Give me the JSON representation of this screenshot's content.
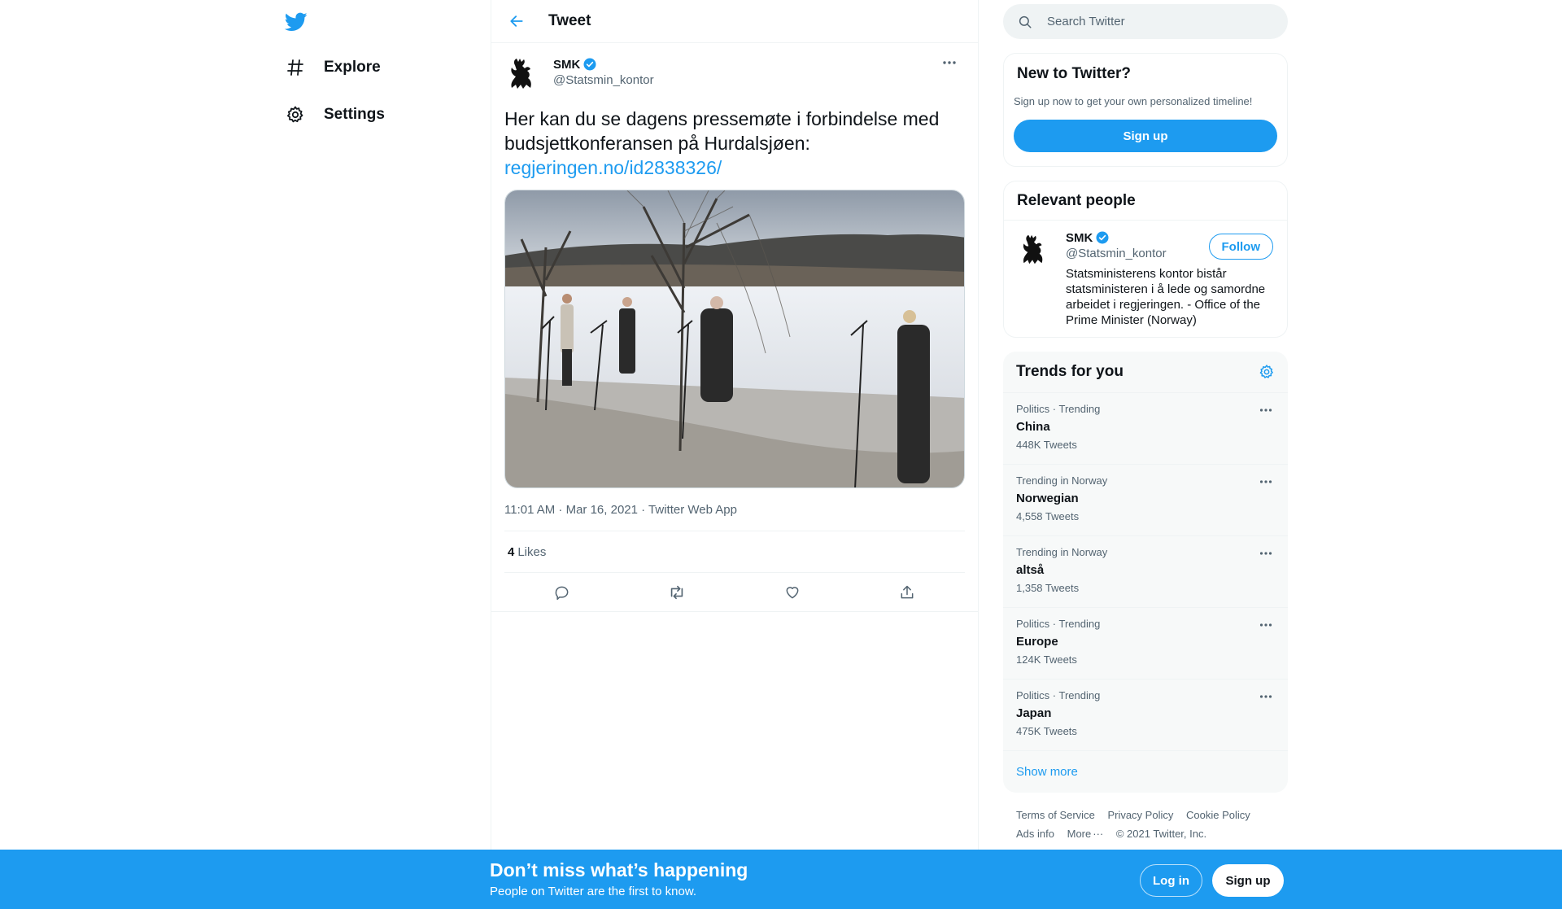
{
  "nav": {
    "logo_icon": "twitter-bird-icon",
    "items": [
      {
        "label": "Explore",
        "icon": "hashtag-icon"
      },
      {
        "label": "Settings",
        "icon": "gear-icon"
      }
    ]
  },
  "header": {
    "title": "Tweet",
    "back_icon": "arrow-left-icon"
  },
  "tweet": {
    "author_name": "SMK",
    "author_handle": "@Statsmin_kontor",
    "verified": true,
    "text": "Her kan du se dagens pressemøte i forbindelse med budsjettkonferansen på Hurdalsjøen:",
    "link": "regjeringen.no/id2838326/",
    "media_description": "photo",
    "timestamp": "11:01 AM · Mar 16, 2021 · Twitter Web App",
    "likes_count": "4",
    "likes_label": "Likes",
    "actions": [
      "reply-icon",
      "retweet-icon",
      "like-icon",
      "share-icon"
    ]
  },
  "search": {
    "placeholder": "Search Twitter"
  },
  "new_to_twitter": {
    "title": "New to Twitter?",
    "subtitle": "Sign up now to get your own personalized timeline!",
    "button": "Sign up"
  },
  "relevant_people": {
    "title": "Relevant people",
    "person": {
      "name": "SMK",
      "handle": "@Statsmin_kontor",
      "bio": "Statsministerens kontor bistår statsministeren i å lede og samordne arbeidet i regjeringen. - Office of the Prime Minister (Norway)",
      "follow_label": "Follow"
    }
  },
  "trends": {
    "title": "Trends for you",
    "items": [
      {
        "context": "Politics · Trending",
        "name": "China",
        "count": "448K Tweets"
      },
      {
        "context": "Trending in Norway",
        "name": "Norwegian",
        "count": "4,558 Tweets"
      },
      {
        "context": "Trending in Norway",
        "name": "altså",
        "count": "1,358 Tweets"
      },
      {
        "context": "Politics · Trending",
        "name": "Europe",
        "count": "124K Tweets"
      },
      {
        "context": "Politics · Trending",
        "name": "Japan",
        "count": "475K Tweets"
      }
    ],
    "show_more": "Show more"
  },
  "footer": {
    "terms": "Terms of Service",
    "privacy": "Privacy Policy",
    "cookie": "Cookie Policy",
    "ads": "Ads info",
    "more": "More",
    "copyright": "© 2021 Twitter, Inc."
  },
  "bottom_bar": {
    "title": "Don’t miss what’s happening",
    "subtitle": "People on Twitter are the first to know.",
    "login": "Log in",
    "signup": "Sign up"
  },
  "colors": {
    "accent": "#1d9bf0",
    "text": "#0f1419",
    "secondary": "#536471"
  }
}
